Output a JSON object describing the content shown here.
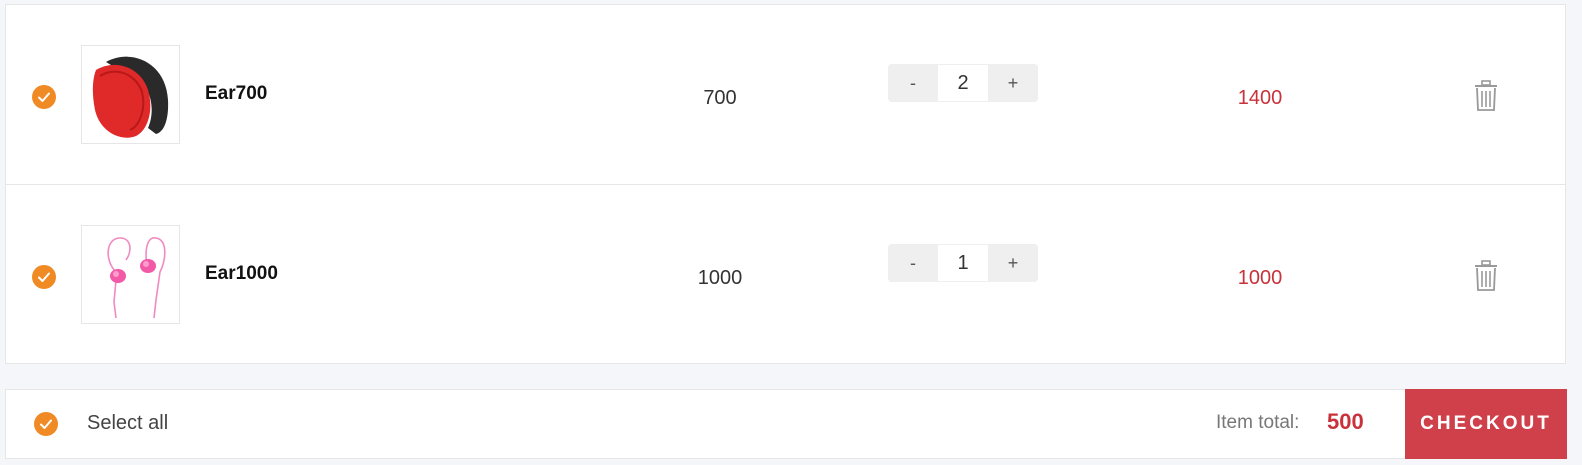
{
  "colors": {
    "accent": "#f08a24",
    "price": "#c8323b",
    "checkout": "#d0404b"
  },
  "items": [
    {
      "name": "Ear700",
      "price": "700",
      "quantity": "2",
      "subtotal": "1400",
      "selected": true,
      "image_icon": "red-headphones-image",
      "minus_label": "-",
      "plus_label": "+"
    },
    {
      "name": "Ear1000",
      "price": "1000",
      "quantity": "1",
      "subtotal": "1000",
      "selected": true,
      "image_icon": "pink-earphones-image",
      "minus_label": "-",
      "plus_label": "+"
    }
  ],
  "footer": {
    "select_all_label": "Select all",
    "total_label": "Item total:",
    "total_value": "500",
    "checkout_label": "CHECKOUT"
  },
  "icons": {
    "check": "check-icon",
    "delete": "trash-icon"
  }
}
